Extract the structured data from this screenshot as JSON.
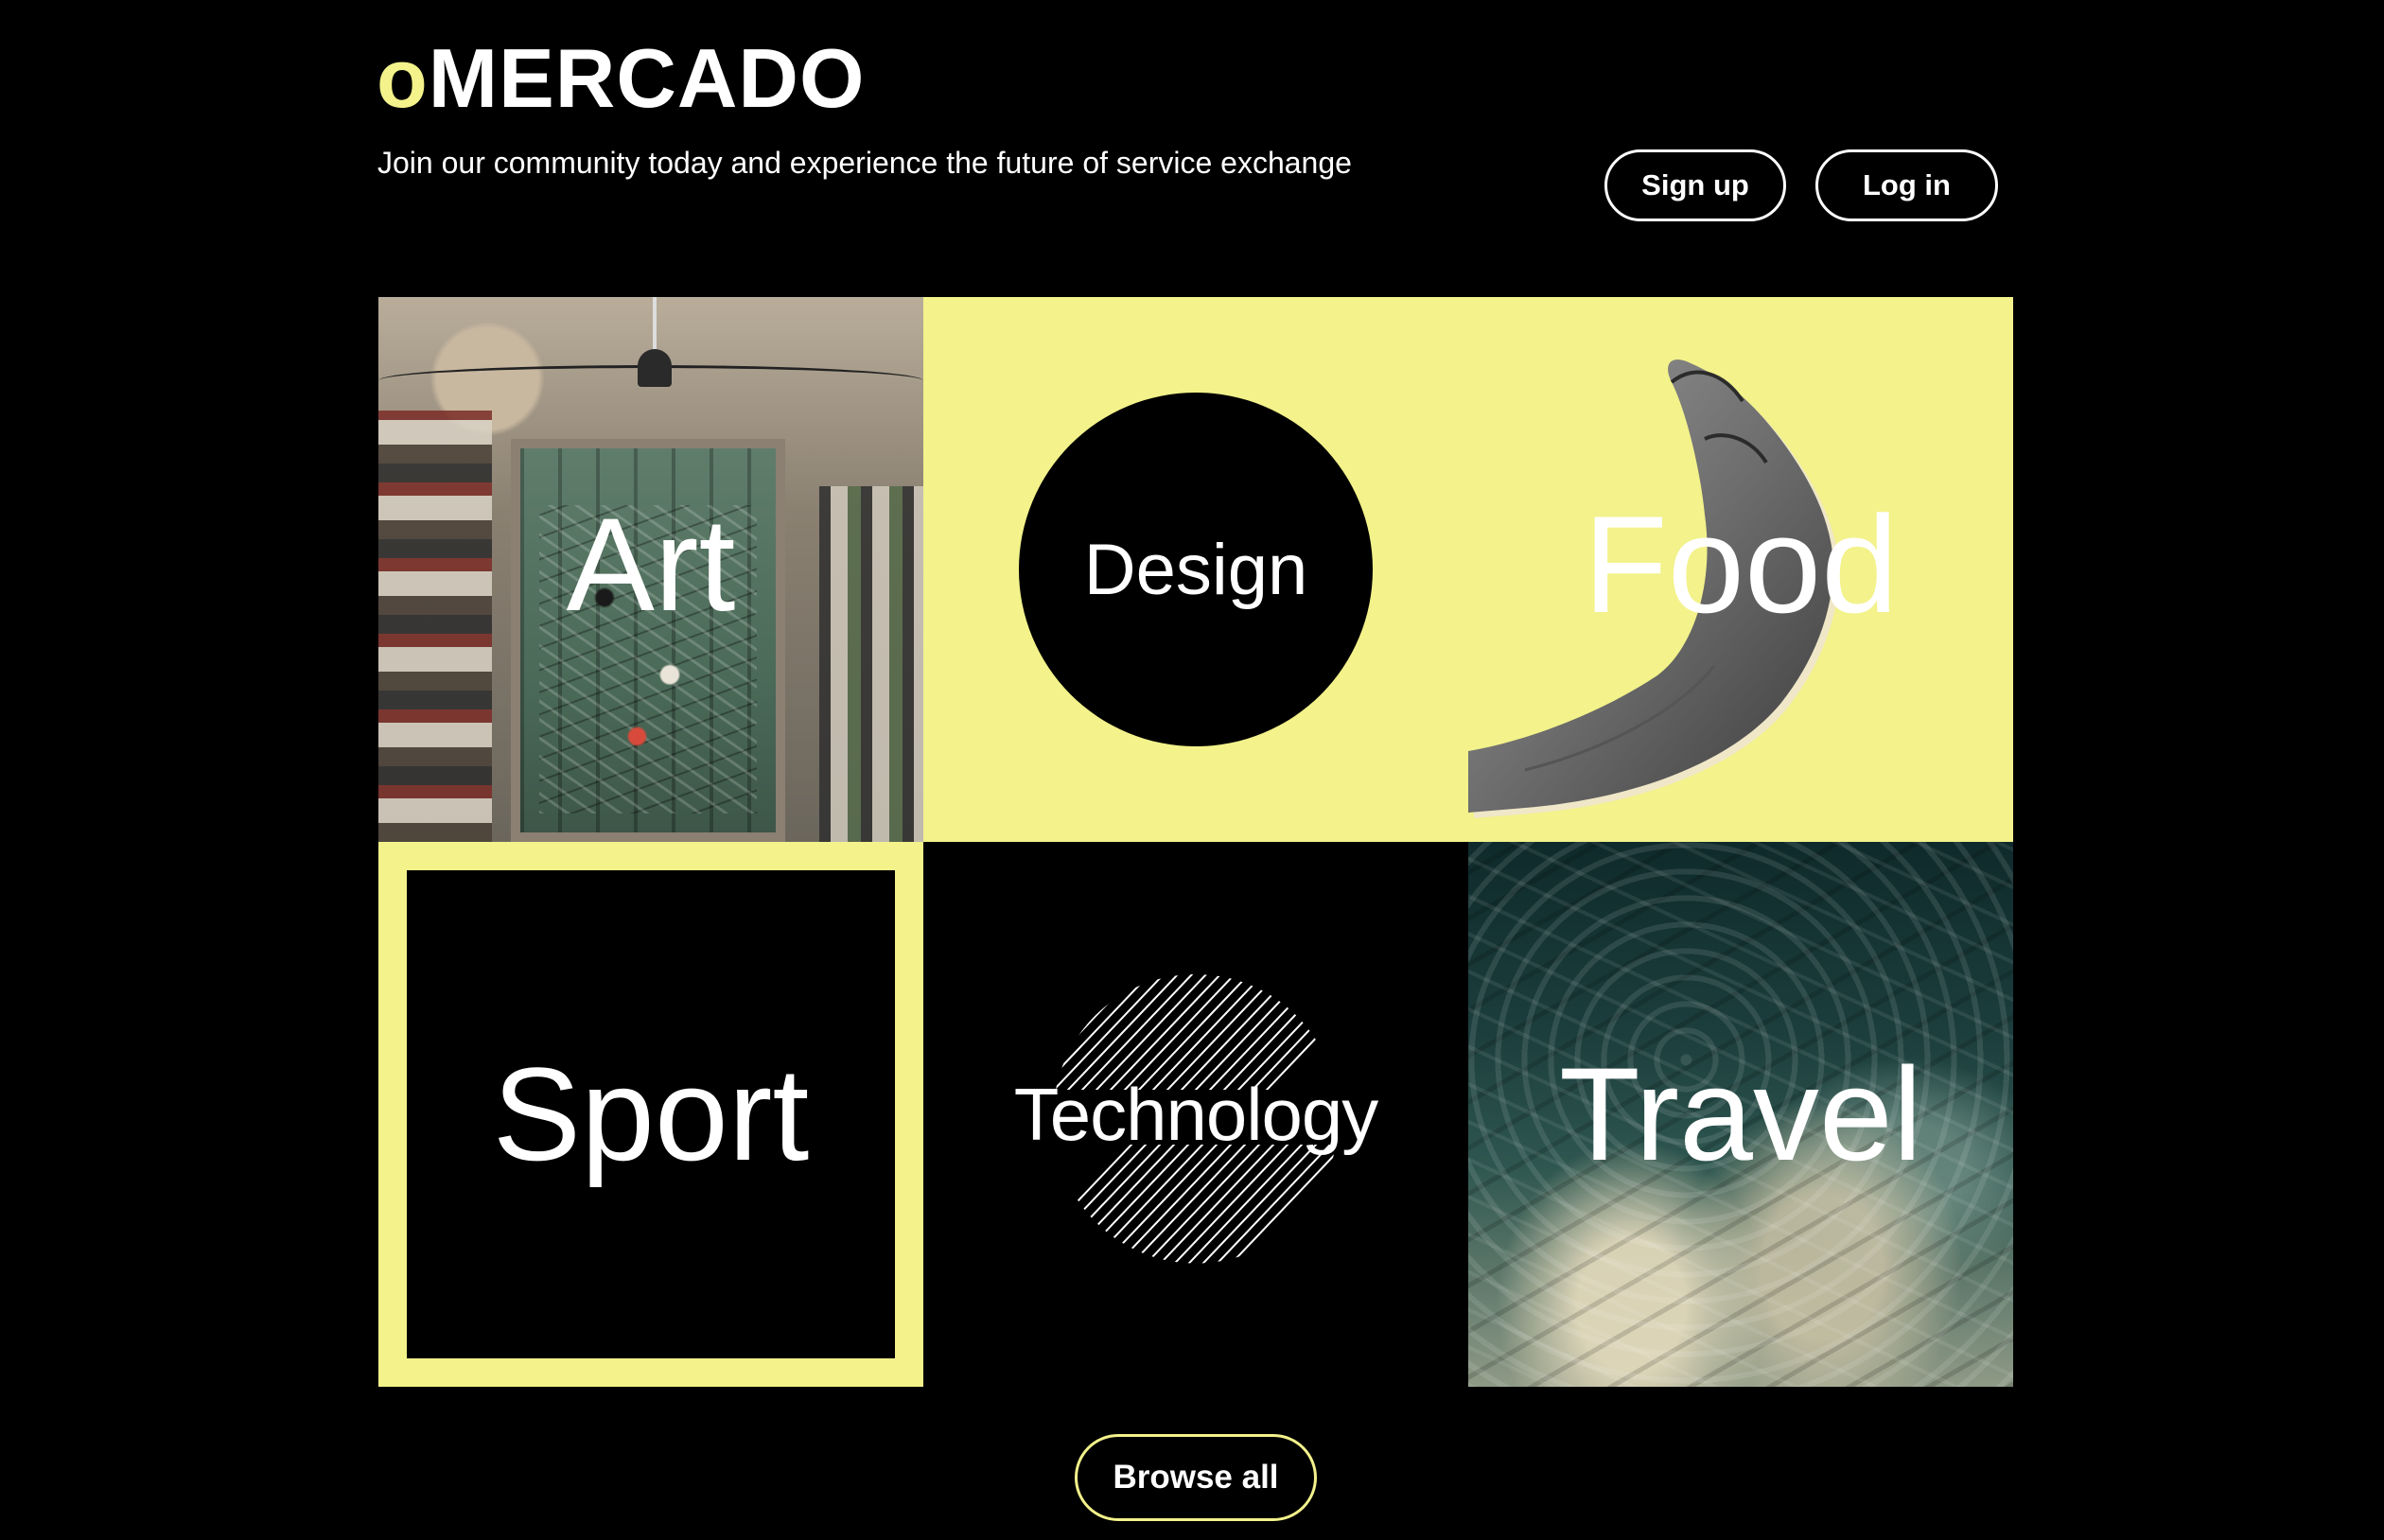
{
  "brand": {
    "logo_prefix": "o",
    "logo_main": "MERCADO",
    "accent_color": "#f3f28b"
  },
  "header": {
    "tagline": "Join our community today and experience the future of service exchange",
    "signup_label": "Sign up",
    "login_label": "Log in"
  },
  "categories": [
    {
      "label": "Art"
    },
    {
      "label": "Design"
    },
    {
      "label": "Food"
    },
    {
      "label": "Sport"
    },
    {
      "label": "Technology"
    },
    {
      "label": "Travel"
    }
  ],
  "footer": {
    "browse_label": "Browse all"
  }
}
